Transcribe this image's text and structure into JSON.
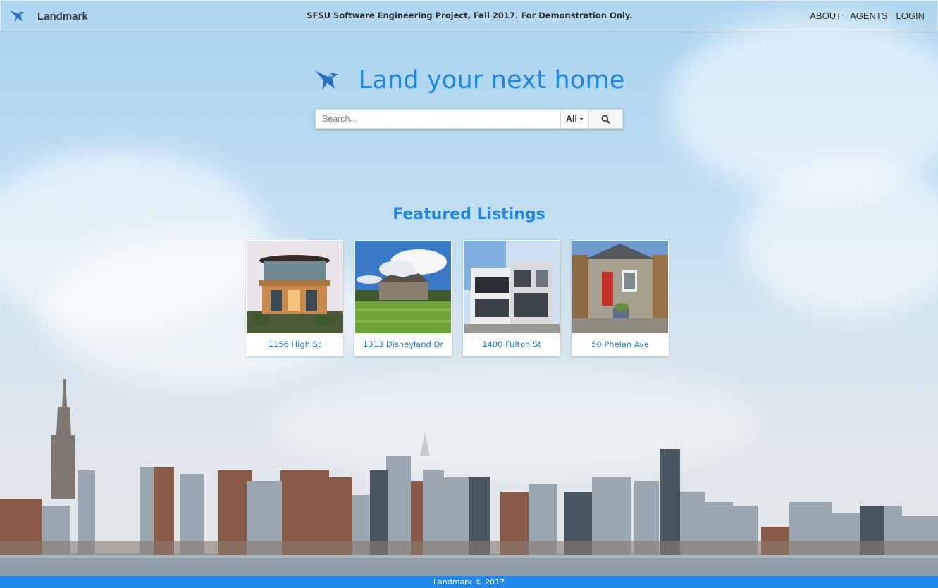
{
  "colors": {
    "accent": "#1d86e6",
    "footer_bg": "#1e88ec",
    "nav_text": "#333333"
  },
  "navbar": {
    "brand_icon": "bird-logo-icon",
    "brand_name": "Landmark",
    "notice": "SFSU Software Engineering Project, Fall 2017. For Demonstration Only.",
    "links": [
      "ABOUT",
      "AGENTS",
      "LOGIN"
    ]
  },
  "hero": {
    "title": "Land your next home",
    "logo_icon": "bird-logo-icon"
  },
  "search": {
    "placeholder": "Search...",
    "value": "",
    "filter_selected": "All",
    "button_icon": "search-icon"
  },
  "featured": {
    "title": "Featured Listings",
    "listings": [
      {
        "address": "1156 High St"
      },
      {
        "address": "1313 Disneyland Dr"
      },
      {
        "address": "1400 Fulton St"
      },
      {
        "address": "50 Phelan Ave"
      }
    ]
  },
  "footer": {
    "text": "Landmark © 2017"
  }
}
